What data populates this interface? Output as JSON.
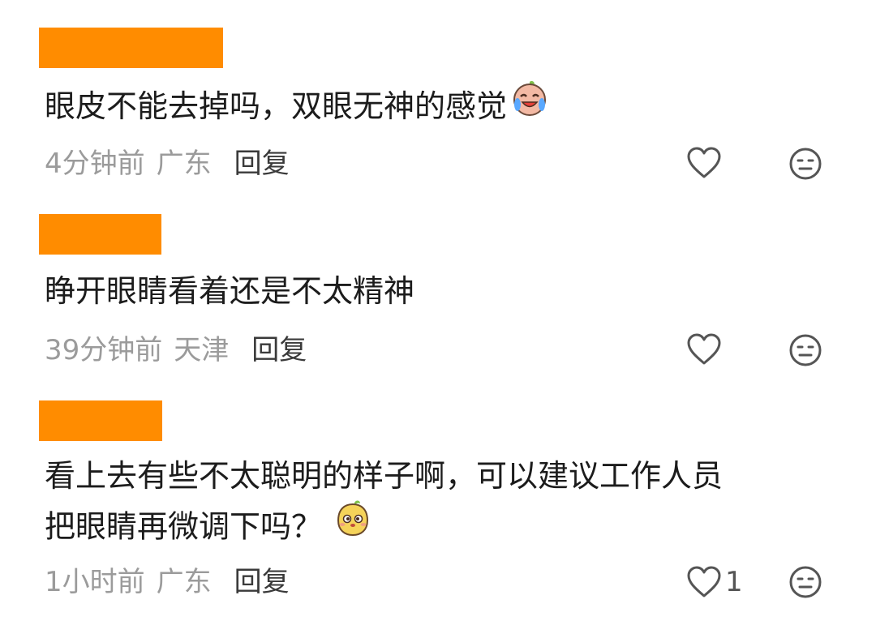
{
  "comments": [
    {
      "username_redaction_color": "#ff8c00",
      "text": "眼皮不能去掉吗，双眼无神的感觉",
      "emoji": "crying-laughing-emoji",
      "time": "4分钟前",
      "region": "广东",
      "reply_label": "回复",
      "like_count": ""
    },
    {
      "username_redaction_color": "#ff8c00",
      "text": "睁开眼睛看着还是不太精神",
      "emoji": "",
      "time": "39分钟前",
      "region": "天津",
      "reply_label": "回复",
      "like_count": ""
    },
    {
      "username_redaction_color": "#ff8c00",
      "text_line1": "看上去有些不太聪明的样子啊，可以建议工作人员",
      "text_line2": "把眼睛再微调下吗？",
      "emoji": "silly-face-emoji",
      "time": "1小时前",
      "region": "广东",
      "reply_label": "回复",
      "like_count": "1"
    }
  ],
  "icons": {
    "like": "heart-outline-icon",
    "dislike": "meh-face-icon"
  },
  "colors": {
    "redaction": "#ff8c00",
    "meta_gray": "#9b9b9b",
    "icon_gray": "#555555"
  }
}
